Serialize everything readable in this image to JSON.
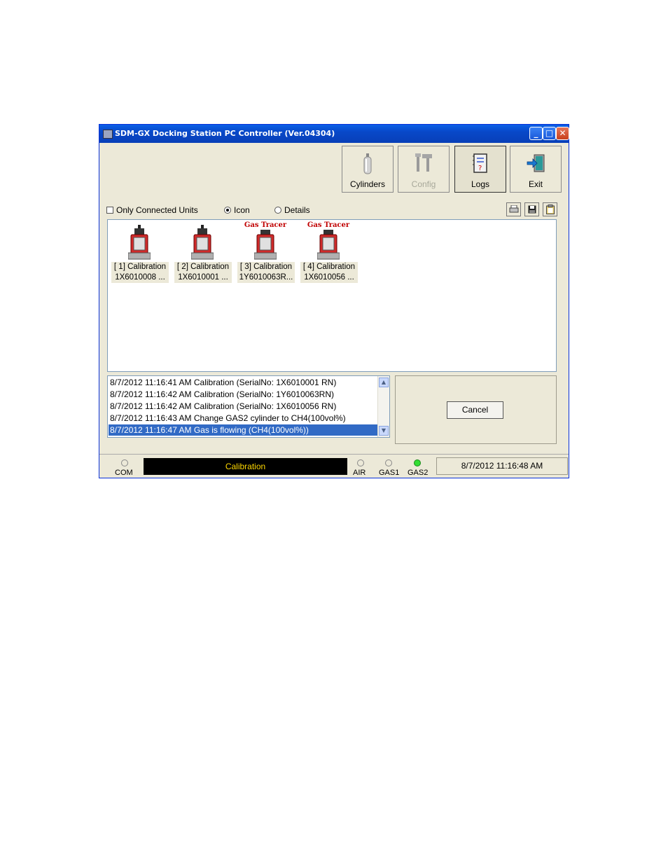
{
  "window": {
    "title": "SDM-GX Docking Station PC Controller (Ver.04304)"
  },
  "toolbar": {
    "cylinders_label": "Cylinders",
    "config_label": "Config",
    "logs_label": "Logs",
    "exit_label": "Exit"
  },
  "options": {
    "only_connected_label": "Only Connected Units",
    "only_connected_checked": false,
    "icon_label": "Icon",
    "details_label": "Details",
    "selected_view": "Icon"
  },
  "units": [
    {
      "gas_label": "",
      "line1": "[ 1] Calibration",
      "line2": "1X6010008 ..."
    },
    {
      "gas_label": "",
      "line1": "[ 2] Calibration",
      "line2": "1X6010001 ..."
    },
    {
      "gas_label": "Gas Tracer",
      "line1": "[ 3] Calibration",
      "line2": "1Y6010063R..."
    },
    {
      "gas_label": "Gas Tracer",
      "line1": "[ 4] Calibration",
      "line2": "1X6010056 ..."
    }
  ],
  "log": [
    "8/7/2012 11:16:41 AM Calibration (SerialNo: 1X6010001 RN)",
    "8/7/2012 11:16:42 AM Calibration (SerialNo: 1Y6010063RN)",
    "8/7/2012 11:16:42 AM Calibration (SerialNo: 1X6010056 RN)",
    "8/7/2012 11:16:43 AM Change GAS2 cylinder to CH4(100vol%)",
    "8/7/2012 11:16:47 AM Gas is flowing (CH4(100vol%))"
  ],
  "cancel_label": "Cancel",
  "status": {
    "com_label": "COM",
    "mode_text": "Calibration",
    "air_label": "AIR",
    "gas1_label": "GAS1",
    "gas2_label": "GAS2",
    "gas2_active": true,
    "datetime": "8/7/2012 11:16:48 AM",
    "mode_color": "#ffd800",
    "led_on_color": "#33dd33"
  }
}
